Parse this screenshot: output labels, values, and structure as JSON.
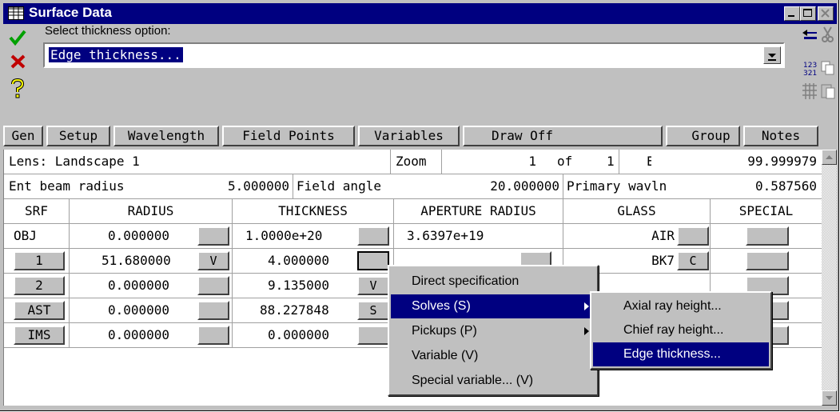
{
  "window": {
    "title": "Surface Data",
    "title_icon": "table-icon"
  },
  "top": {
    "prompt": "Select thickness option:",
    "combo_value": "Edge thickness...",
    "left_icons": [
      "checkmark-icon",
      "close-x-icon",
      "help-icon"
    ],
    "right_icons": [
      "edit-icon",
      "cut-icon",
      "sort-icon",
      "copy-icon",
      "grid-icon",
      "paste-icon"
    ]
  },
  "tabs": [
    "Gen",
    "Setup",
    "Wavelength",
    "Field Points",
    "Variables",
    "Draw Off",
    "Group",
    "Notes"
  ],
  "info": {
    "lens_label": "Lens: Landscape 1",
    "zoom_label": "Zoom",
    "zoom_value": "1",
    "of_label": "of",
    "zoom_total": "1",
    "efl_label": "Efl",
    "efl_value": "99.999979",
    "ebr_label": "Ent beam radius",
    "ebr_value": "5.000000",
    "fa_label": "Field angle",
    "fa_value": "20.000000",
    "pw_label": "Primary wavln",
    "pw_value": "0.587560"
  },
  "columns": [
    "SRF",
    "RADIUS",
    "THICKNESS",
    "APERTURE RADIUS",
    "GLASS",
    "SPECIAL"
  ],
  "rows": [
    {
      "srf": "OBJ",
      "radius": "0.000000",
      "rflag": "",
      "thickness": "1.0000e+20",
      "tflag": "",
      "aperture": "3.6397e+19",
      "glass": "AIR",
      "gflag": ""
    },
    {
      "srf": "1",
      "radius": "51.680000",
      "rflag": "V",
      "thickness": "4.000000",
      "tflag": "",
      "aperture": "",
      "glass": "BK7",
      "gflag": "C"
    },
    {
      "srf": "2",
      "radius": "0.000000",
      "rflag": "",
      "thickness": "9.135000",
      "tflag": "V",
      "aperture": "",
      "glass": "",
      "gflag": ""
    },
    {
      "srf": "AST",
      "radius": "0.000000",
      "rflag": "",
      "thickness": "88.227848",
      "tflag": "S",
      "aperture": "",
      "glass": "",
      "gflag": ""
    },
    {
      "srf": "IMS",
      "radius": "0.000000",
      "rflag": "",
      "thickness": "0.000000",
      "tflag": "",
      "aperture": "",
      "glass": "",
      "gflag": ""
    }
  ],
  "menu": {
    "items": [
      "Direct specification",
      "Solves (S)",
      "Pickups (P)",
      "Variable (V)",
      "Special variable... (V)"
    ],
    "selected": "Solves (S)"
  },
  "submenu": {
    "items": [
      "Axial ray height...",
      "Chief ray height...",
      "Edge thickness..."
    ],
    "selected": "Edge thickness..."
  },
  "colors": {
    "titlebar": "#000080",
    "face": "#c0c0c0",
    "highlight": "#000080"
  }
}
